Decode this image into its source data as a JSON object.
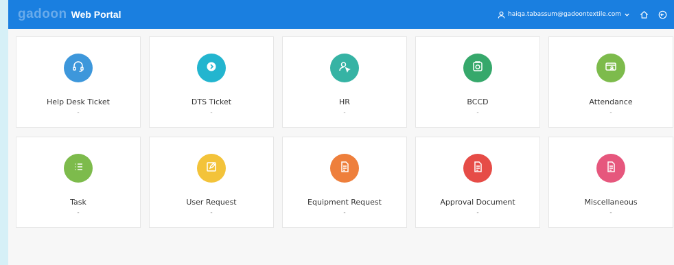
{
  "header": {
    "logo_text": "gadoon",
    "title": "Web Portal",
    "user_email": "haiqa.tabassum@gadoontextile.com",
    "icons": {
      "user": "user-icon",
      "dropdown": "chevron-down-icon",
      "home": "home-icon",
      "logout": "logout-icon"
    }
  },
  "tiles": [
    {
      "label": "Help Desk Ticket",
      "sub": "-",
      "color": "#3d97db",
      "icon": "headset-icon"
    },
    {
      "label": "DTS Ticket",
      "sub": "-",
      "color": "#23b5cf",
      "icon": "chevron-right-circle-icon"
    },
    {
      "label": "HR",
      "sub": "-",
      "color": "#36b3a4",
      "icon": "user-cursor-icon"
    },
    {
      "label": "BCCD",
      "sub": "-",
      "color": "#36a86b",
      "icon": "camera-box-icon"
    },
    {
      "label": "Attendance",
      "sub": "-",
      "color": "#7dbb4c",
      "icon": "id-card-icon"
    },
    {
      "label": "Task",
      "sub": "-",
      "color": "#7dbb4c",
      "icon": "checklist-icon"
    },
    {
      "label": "User Request",
      "sub": "-",
      "color": "#f3c33a",
      "icon": "edit-icon"
    },
    {
      "label": "Equipment Request",
      "sub": "-",
      "color": "#ee7f3c",
      "icon": "document-icon"
    },
    {
      "label": "Approval Document",
      "sub": "-",
      "color": "#e64c47",
      "icon": "document-icon"
    },
    {
      "label": "Miscellaneous",
      "sub": "-",
      "color": "#e6577d",
      "icon": "document-icon"
    }
  ]
}
